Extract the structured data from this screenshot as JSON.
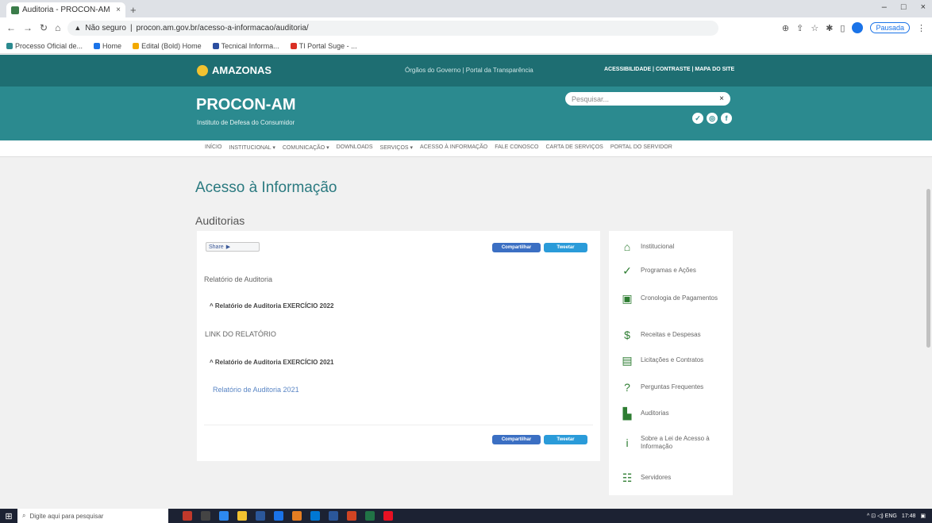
{
  "browser": {
    "tab_title": "Auditoria - PROCON-AM",
    "tab_close": "×",
    "new_tab": "+",
    "window_controls": [
      "–",
      "□",
      "×"
    ],
    "nav_icons": [
      "←",
      "→",
      "↻",
      "⌂"
    ],
    "url_prefix": "Não seguro",
    "url": "procon.am.gov.br/acesso-a-informacao/auditoria/",
    "pausado": "Pausada",
    "bookmarks": [
      "Processo Oficial de...",
      "Home",
      "Edital (Bold) Home",
      "Tecnical Informa...",
      "TI Portal Suge - ..."
    ]
  },
  "header": {
    "logo_text": "AMAZONAS",
    "center_links": "Órgãos do Governo  |  Portal da Transparência",
    "right_links": "ACESSIBILIDADE  |  CONTRASTE  |  MAPA DO SITE",
    "site_name": "PROCON-AM",
    "site_subtitle": "Instituto de Defesa do Consumidor",
    "search_placeholder": "Pesquisar...",
    "search_icon": "×",
    "social": [
      "✓",
      "◎",
      "f"
    ]
  },
  "nav": {
    "items": [
      "INÍCIO",
      "INSTITUCIONAL ▾",
      "COMUNICAÇÃO ▾",
      "DOWNLOADS",
      "SERVIÇOS ▾",
      "ACESSO À INFORMAÇÃO",
      "FALE CONOSCO",
      "CARTA DE SERVIÇOS",
      "PORTAL DO SERVIDOR"
    ]
  },
  "main": {
    "page_title": "Acesso à Informação",
    "section_title": "Auditorias",
    "share_label": "Share",
    "share_icon": "▶",
    "btn_facebook": "Compartilhar",
    "btn_twitter": "Tweetar",
    "report_label": "Relatório de Auditoria",
    "accordion_2022": "^  Relatório de Auditoria EXERCÍCIO 2022",
    "link_2022": "LINK DO RELATÓRIO",
    "accordion_2021": "^  Relatório de Auditoria EXERCÍCIO 2021",
    "link_2021": "Relatório de Auditoria 2021"
  },
  "sidebar": {
    "items": [
      {
        "label": "Institucional",
        "icon": "⌂"
      },
      {
        "label": "Programas e Ações",
        "icon": "✓"
      },
      {
        "label": "Cronologia de Pagamentos",
        "icon": "▣"
      },
      {
        "label": "Receitas e Despesas",
        "icon": "$"
      },
      {
        "label": "Licitações e Contratos",
        "icon": "▤"
      },
      {
        "label": "Perguntas Frequentes",
        "icon": "?"
      },
      {
        "label": "Auditorias",
        "icon": "▙"
      },
      {
        "label": "Sobre a Lei de Acesso à Informação",
        "icon": "i"
      },
      {
        "label": "Servidores",
        "icon": "☷"
      }
    ]
  },
  "taskbar": {
    "start_icon": "⊞",
    "search_placeholder": "Digite aqui para pesquisar",
    "tray_text": "^  ⊡  ◁)  ENG",
    "clock": "17:48"
  }
}
